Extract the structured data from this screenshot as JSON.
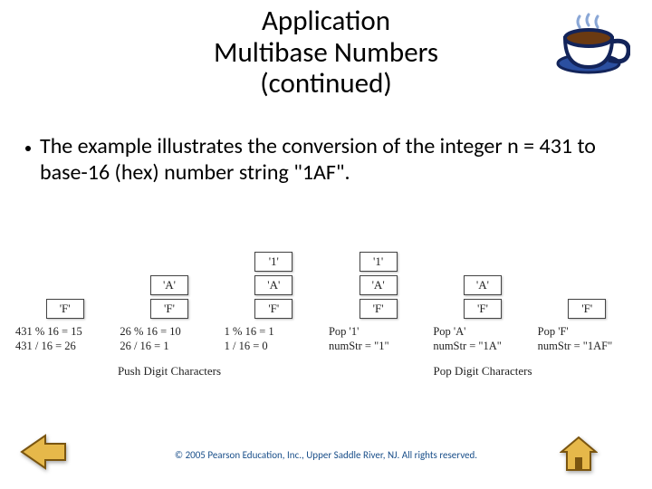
{
  "title_lines": [
    "Application",
    "Multibase Numbers",
    "(continued)"
  ],
  "bullet": "The example illustrates the conversion of the integer n = 431 to base-16 (hex) number string \"1AF\".",
  "diagram": {
    "columns": [
      {
        "stack": [
          "'F'"
        ],
        "calc": "431 % 16 = 15\n431 / 16 = 26"
      },
      {
        "stack": [
          "'A'",
          "'F'"
        ],
        "calc": "26 % 16 = 10\n26 / 16 = 1"
      },
      {
        "stack": [
          "'1'",
          "'A'",
          "'F'"
        ],
        "calc": "1 % 16 = 1\n1 / 16 = 0"
      },
      {
        "stack": [
          "'1'",
          "'A'",
          "'F'"
        ],
        "calc": "Pop '1'\nnumStr = \"1\""
      },
      {
        "stack": [
          "'A'",
          "'F'"
        ],
        "calc": "Pop 'A'\nnumStr = \"1A\""
      },
      {
        "stack": [
          "'F'"
        ],
        "calc": "Pop 'F'\nnumStr = \"1AF\""
      }
    ],
    "section_labels": {
      "push": "Push Digit Characters",
      "pop": "Pop Digit Characters"
    }
  },
  "copyright": "© 2005 Pearson Education, Inc., Upper Saddle River, NJ. All rights reserved.",
  "icons": {
    "cup": "coffee-cup-icon",
    "prev": "previous-arrow-icon",
    "home": "home-icon"
  }
}
